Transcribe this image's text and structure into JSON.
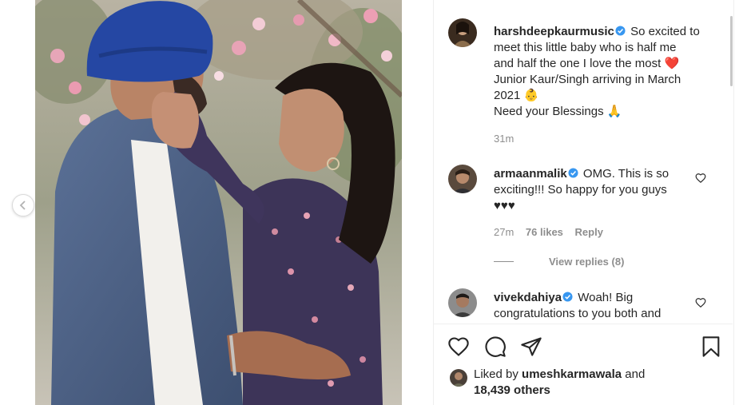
{
  "post": {
    "author": "harshdeepkaurmusic",
    "caption_lines": [
      "So excited to",
      "meet this little baby who is half me",
      "and half the one I love the most ❤️",
      "Junior Kaur/Singh arriving in March",
      "2021 👶",
      "Need your Blessings 🙏"
    ],
    "time": "31m"
  },
  "comments": [
    {
      "username": "armaanmalik",
      "text_lines": [
        "OMG. This is so",
        "exciting!!! So happy for you guys",
        "♥♥♥"
      ],
      "time": "27m",
      "likes": "76 likes",
      "reply": "Reply",
      "view_replies": "View replies (8)"
    },
    {
      "username": "vivekdahiya",
      "text_lines": [
        "Woah! Big",
        "congratulations to you both and"
      ]
    }
  ],
  "actions": {
    "liked_by_prefix": "Liked by",
    "liked_by_user": "umeshkarmawala",
    "liked_by_and": "and",
    "others": "18,439 others"
  },
  "icons": {
    "like": "heart-icon",
    "comment": "comment-icon",
    "share": "paper-plane-icon",
    "save": "bookmark-icon",
    "prev": "chevron-left-icon",
    "verified": "verified-badge-icon"
  },
  "colors": {
    "verified": "#3897f0",
    "text": "#262626",
    "muted": "#8e8e8e",
    "border": "#efefef"
  }
}
